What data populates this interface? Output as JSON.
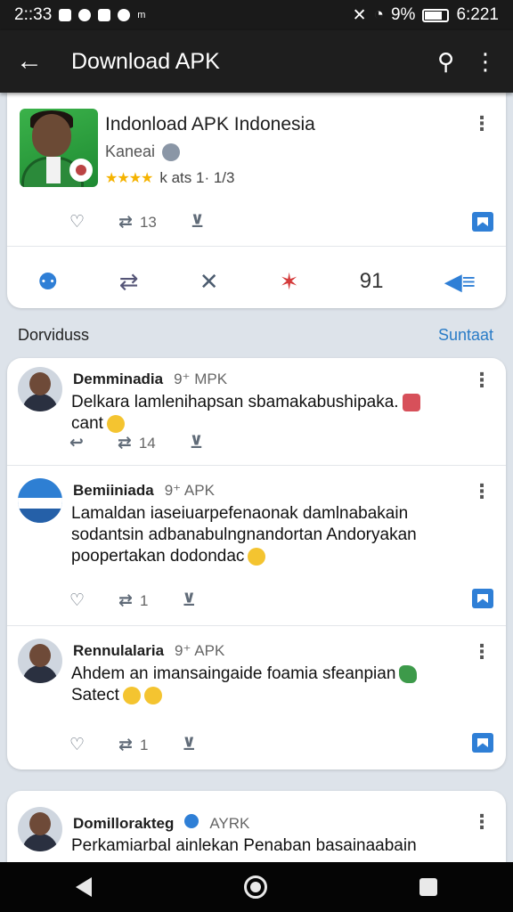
{
  "status_bar": {
    "time": "2::33",
    "right_small": "m",
    "battery": "9%",
    "right_time": "6:221"
  },
  "app_bar": {
    "title": "Download APK"
  },
  "app": {
    "name": "Indonload APK Indonesia",
    "developer": "Kaneai",
    "stars": "★★★★",
    "rating_text": "k ats  1· 1/3",
    "stat_count": "13"
  },
  "share_row": {
    "count": "91"
  },
  "section": {
    "title": "Dorviduss",
    "link": "Suntaat"
  },
  "posts": [
    {
      "name": "Demminadia",
      "tag": "9⁺ MPK",
      "body_line1": "Delkara lamlenihapsan sbamakabushipaka.",
      "body_line2": "cant",
      "stat_count": "14"
    },
    {
      "name": "Bemiiniada",
      "tag": "9⁺ APK",
      "body_line1": "Lamaldan iaseiuarpefenaonak damlnabakain",
      "body_line2": "sodantsin adbanabulngnandortan Andoryakan",
      "body_line3": "poopertakan dodondac",
      "stat_count": "1"
    },
    {
      "name": "Rennulalaria",
      "tag": "9⁺ APK",
      "body_line1": "Ahdem an imansaingaide foamia sfeanpian",
      "body_line2": "Satect",
      "stat_count": "1"
    },
    {
      "name": "Domillorakteg",
      "tag": "AYRK",
      "body_line1": "Perkamiarbal ainlekan Penaban basainaabain"
    }
  ]
}
